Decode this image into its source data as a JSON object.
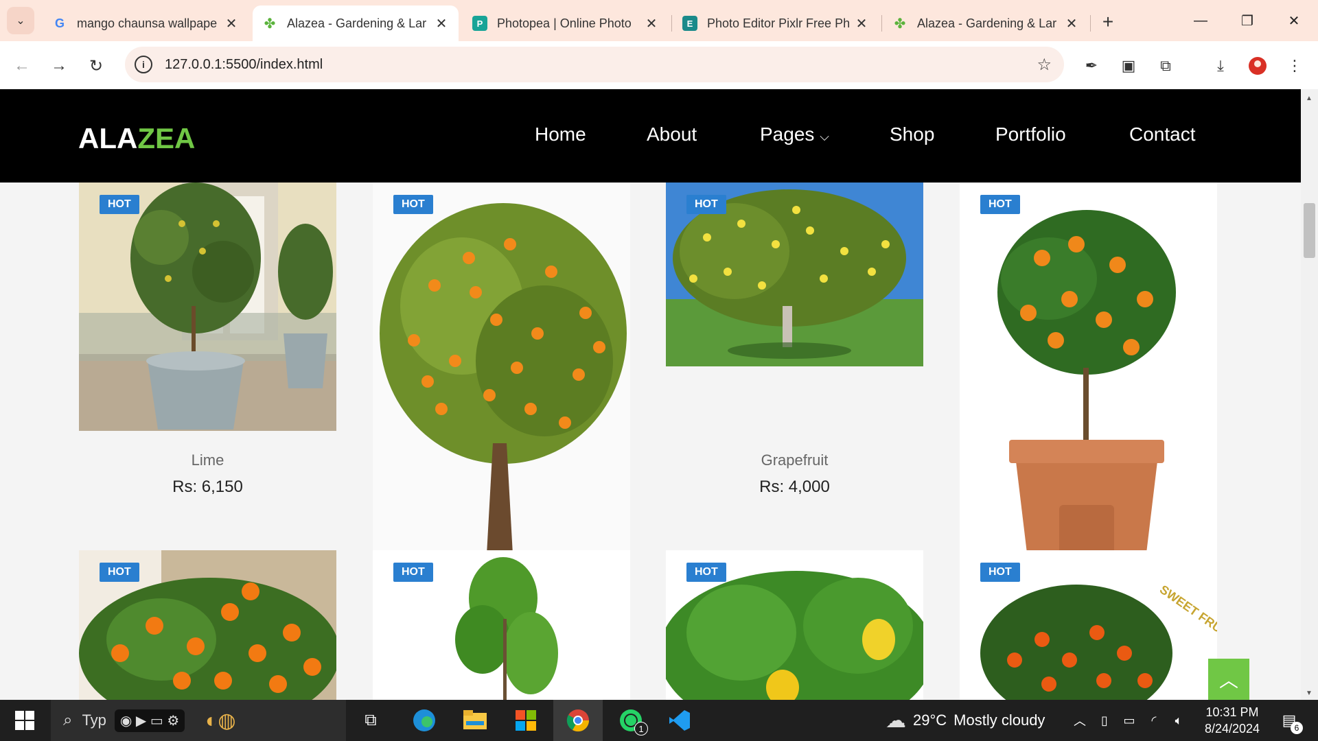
{
  "browser": {
    "tabs": [
      {
        "title": "mango chaunsa wallpape",
        "favicon": "google-icon"
      },
      {
        "title": "Alazea - Gardening & Lar",
        "favicon": "clover-icon"
      },
      {
        "title": "Photopea | Online Photo",
        "favicon": "photopea-icon"
      },
      {
        "title": "Photo Editor Pixlr Free Ph",
        "favicon": "pixlr-icon"
      },
      {
        "title": "Alazea - Gardening & Lar",
        "favicon": "clover-icon"
      }
    ],
    "active_tab_index": 1,
    "url": "127.0.0.1:5500/index.html"
  },
  "site": {
    "logo_part1": "ALA",
    "logo_part2": "ZEA",
    "nav": [
      "Home",
      "About",
      "Pages",
      "Shop",
      "Portfolio",
      "Contact"
    ],
    "accent_color": "#70c745",
    "badge_color": "#2a7fd0"
  },
  "products": [
    {
      "badge": "HOT",
      "name": "Lime",
      "price": "Rs: 6,150",
      "image": "potted lime tree"
    },
    {
      "badge": "HOT",
      "name": "",
      "price": "",
      "image": "orange tree"
    },
    {
      "badge": "HOT",
      "name": "Grapefruit",
      "price": "Rs: 4,000",
      "image": "grapefruit tree on lawn"
    },
    {
      "badge": "HOT",
      "name": "",
      "price": "",
      "image": "orange tree in terracotta pot"
    },
    {
      "badge": "HOT",
      "name": "",
      "price": "",
      "image": "orange branches"
    },
    {
      "badge": "HOT",
      "name": "",
      "price": "",
      "image": "green citrus plant"
    },
    {
      "badge": "HOT",
      "name": "",
      "price": "",
      "image": "lemon leaves"
    },
    {
      "badge": "HOT",
      "name": "",
      "price": "",
      "image": "kumquat tree"
    }
  ],
  "stamp_text": "SWEET FRUIT",
  "taskbar": {
    "search_placeholder": "Typ",
    "weather_temp": "29°C",
    "weather_text": "Mostly cloudy",
    "time": "10:31 PM",
    "date": "8/24/2024",
    "whatsapp_badge": "1",
    "notification_count": "6"
  }
}
